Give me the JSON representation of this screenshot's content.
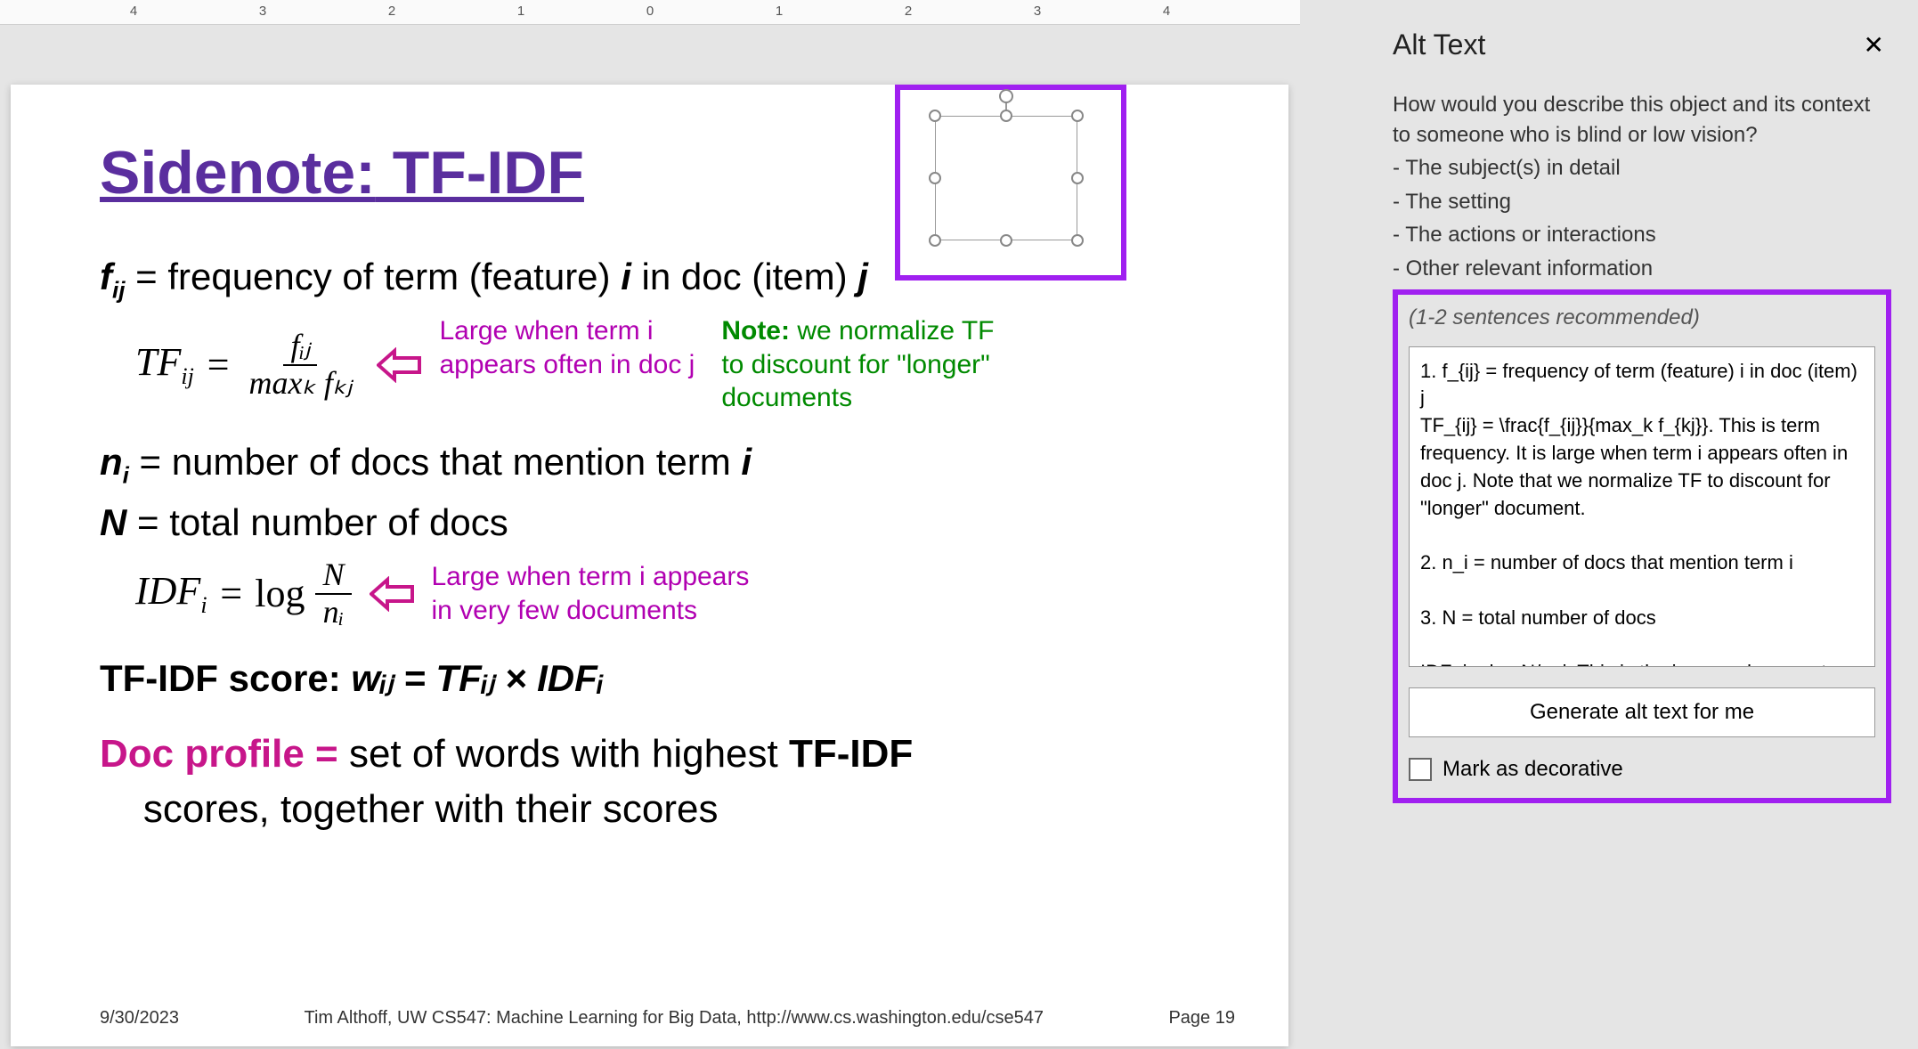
{
  "ruler": {
    "marks": [
      "4",
      "3",
      "2",
      "1",
      "0",
      "1",
      "2",
      "3",
      "4"
    ]
  },
  "slide": {
    "title_part1": "Sidenote:",
    "title_part2": " TF-IDF",
    "line_fij": "fᵢⱼ = frequency of term (feature) i in doc (item) j",
    "formula_tf_lhs": "TF",
    "formula_tf_sub": "ij",
    "formula_tf_eq": "=",
    "formula_tf_num": "fᵢⱼ",
    "formula_tf_den": "maxₖ fₖⱼ",
    "annot_tf_purple_1": "Large when term i",
    "annot_tf_purple_2": "appears often in doc j",
    "annot_tf_green_1": "Note:",
    "annot_tf_green_2": " we normalize TF to discount for \"longer\" documents",
    "line_ni": "nᵢ = number of docs that mention term i",
    "line_N": "N = total number of docs",
    "formula_idf_lhs": "IDF",
    "formula_idf_sub": "i",
    "formula_idf_eq": "=",
    "formula_idf_log": "log",
    "formula_idf_num": "N",
    "formula_idf_den": "nᵢ",
    "annot_idf_1": "Large when term i appears",
    "annot_idf_2": "in very few documents",
    "score_label": "TF-IDF score:  ",
    "score_formula": "wᵢⱼ = TFᵢⱼ × IDFᵢ",
    "doc_profile_label": "Doc profile = ",
    "doc_profile_rest_1": "set of words with highest ",
    "doc_profile_bold": "TF-IDF",
    "doc_profile_rest_2": " scores, together with their scores",
    "footer_date": "9/30/2023",
    "footer_center": "Tim Althoff, UW CS547: Machine Learning for Big Data, http://www.cs.washington.edu/cse547",
    "footer_page": "Page 19"
  },
  "pane": {
    "title": "Alt Text",
    "desc_intro": "How would you describe this object and its context to someone who is blind or low vision?",
    "desc_b1": "- The subject(s) in detail",
    "desc_b2": "- The setting",
    "desc_b3": "- The actions or interactions",
    "desc_b4": "- Other relevant information",
    "reco": "(1-2 sentences recommended)",
    "textarea_value": "1. f_{ij} = frequency of term (feature) i in doc (item) j\nTF_{ij} = \\frac{f_{ij}}{max_k f_{kj}}. This is term frequency. It is large when term i appears often in doc j. Note that we normalize TF to discount for \"longer\" document.\n\n2. n_i = number of docs that mention term i\n\n3. N = total number of docs\n\nIDF_i = log N/n_i. This is the inverse document",
    "gen_button": "Generate alt text for me",
    "decorative_label": "Mark as decorative"
  }
}
